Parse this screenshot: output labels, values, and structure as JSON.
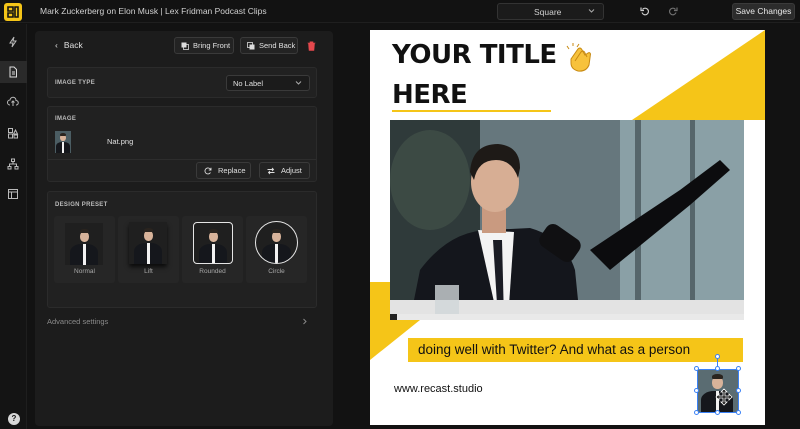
{
  "header": {
    "title": "Mark Zuckerberg on Elon Musk | Lex Fridman Podcast Clips",
    "format": "Square",
    "save_label": "Save Changes"
  },
  "rail": {
    "items": [
      "flash-icon",
      "document-icon",
      "upload-icon",
      "elements-icon",
      "sitemap-icon",
      "layout-icon"
    ],
    "active_index": 1,
    "help_label": "?"
  },
  "panel": {
    "back_label": "Back",
    "bring_front_label": "Bring Front",
    "send_back_label": "Send Back",
    "image_type": {
      "label": "IMAGE TYPE",
      "value": "No Label"
    },
    "image": {
      "label": "IMAGE",
      "file_name": "Nat.png",
      "replace_label": "Replace",
      "adjust_label": "Adjust"
    },
    "design_preset": {
      "label": "DESIGN PRESET",
      "options": [
        "Normal",
        "Lift",
        "Rounded",
        "Circle"
      ]
    },
    "advanced_label": "Advanced settings"
  },
  "canvas": {
    "title_line1": "YOUR TITLE",
    "title_line2": "HERE",
    "title_emoji": "clapping-hands-icon",
    "caption": "doing well with Twitter? And what as a person",
    "url": "www.recast.studio",
    "progress": 0.02,
    "accent": "#f5c518"
  }
}
